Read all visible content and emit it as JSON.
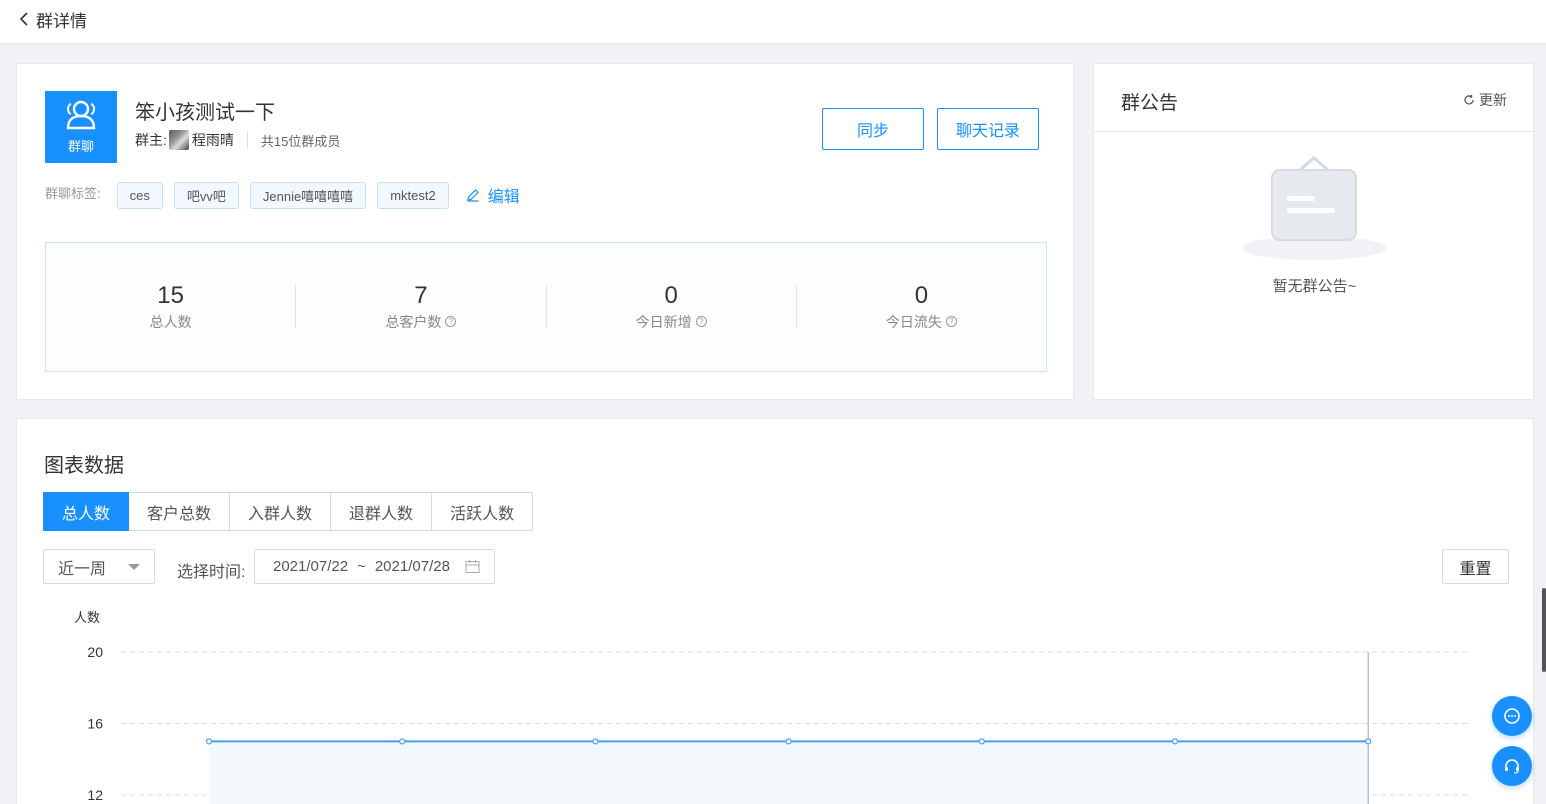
{
  "header": {
    "back_icon": "chevron-left-icon",
    "title": "群详情"
  },
  "group": {
    "avatar_label": "群聊",
    "avatar_icon": "users-icon",
    "name": "笨小孩测试一下",
    "owner_prefix": "群主:",
    "owner_name": "程雨晴",
    "member_count_text": "共15位群成员",
    "sync_button": "同步",
    "chat_record_button": "聊天记录",
    "tags_label": "群聊标签:",
    "tags": [
      "ces",
      "吧vv吧",
      "Jennie嘻嘻嘻嘻",
      "mktest2"
    ],
    "edit_label": "编辑",
    "edit_icon": "pencil-icon"
  },
  "stats": [
    {
      "value": "15",
      "label": "总人数",
      "help": false
    },
    {
      "value": "7",
      "label": "总客户数",
      "help": true
    },
    {
      "value": "0",
      "label": "今日新增",
      "help": true
    },
    {
      "value": "0",
      "label": "今日流失",
      "help": true
    }
  ],
  "notice": {
    "title": "群公告",
    "refresh_label": "更新",
    "refresh_icon": "refresh-icon",
    "empty_text": "暂无群公告~",
    "empty_icon": "empty-board-icon"
  },
  "chart_section": {
    "title": "图表数据",
    "tabs": [
      "总人数",
      "客户总数",
      "入群人数",
      "退群人数",
      "活跃人数"
    ],
    "active_tab": 0,
    "period_select": "近一周",
    "time_label": "选择时间:",
    "date_start": "2021/07/22",
    "date_separator": "~",
    "date_end": "2021/07/28",
    "reset_button": "重置"
  },
  "chart_data": {
    "type": "line",
    "ylabel": "人数",
    "xlabel": "",
    "y_ticks": [
      20,
      16,
      12
    ],
    "series": [
      {
        "values": [
          15,
          15,
          15,
          15,
          15,
          15,
          15
        ]
      }
    ],
    "colors": {
      "line": "#4a9ff5",
      "area": "#f3f8fd",
      "grid": "#dcdcdc",
      "cursor": "#a0a8b3"
    },
    "grid": true
  },
  "floating": {
    "chat_icon": "chat-bubble-icon",
    "support_icon": "headset-icon"
  },
  "colors": {
    "primary": "#1890ff",
    "page_bg": "#f0f2f5"
  }
}
